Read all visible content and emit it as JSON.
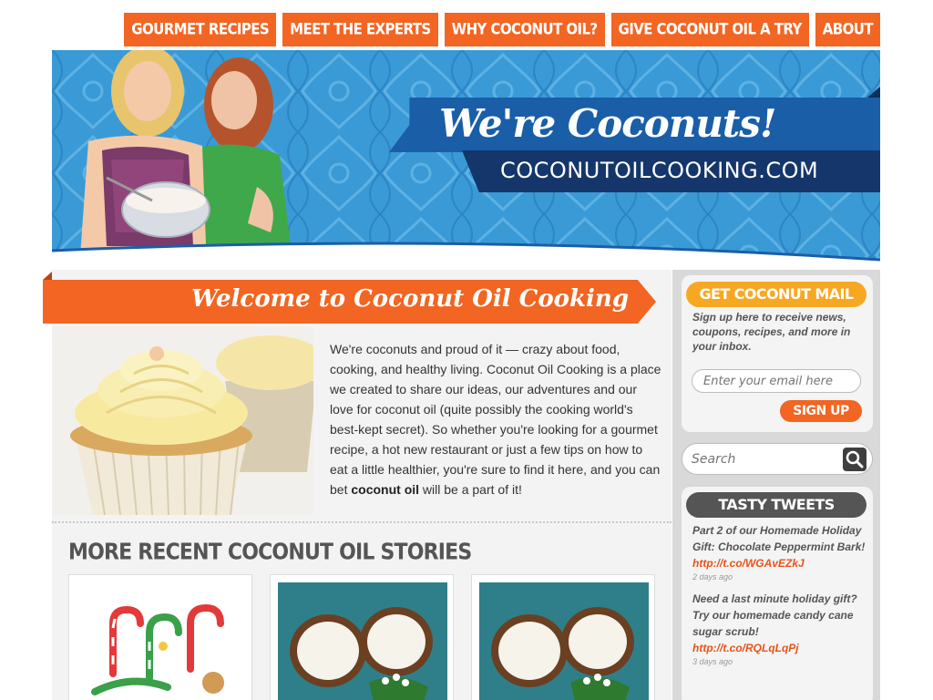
{
  "nav": {
    "items": [
      "GOURMET RECIPES",
      "MEET THE EXPERTS",
      "WHY COCONUT OIL?",
      "GIVE COCONUT OIL A TRY",
      "ABOUT"
    ]
  },
  "hero": {
    "headline": "We're Coconuts!",
    "site_name": "COCONUTOILCOOKING.COM"
  },
  "welcome": {
    "title": "Welcome to Coconut Oil Cooking",
    "body_before_bold": "We're coconuts and proud of it — crazy about food, cooking, and healthy living. Coconut Oil Cooking is a place we created to share our ideas, our adventures and our love for coconut oil (quite possibly the cooking world's best-kept secret). So whether you're looking for a gourmet recipe, a hot new restaurant or just a few tips on how to eat a little healthier, you're sure to find it here, and you can bet ",
    "body_bold": "coconut oil",
    "body_after_bold": " will be a part of it!"
  },
  "stories": {
    "title": "MORE RECENT COCONUT OIL STORIES"
  },
  "newsletter": {
    "title": "GET COCONUT MAIL",
    "description": "Sign up here to receive news, coupons, recipes, and more in your inbox.",
    "email_placeholder": "Enter your email here",
    "signup_label": "SIGN UP"
  },
  "search": {
    "placeholder": "Search"
  },
  "tweets": {
    "title": "TASTY TWEETS",
    "items": [
      {
        "text": "Part 2 of our Homemade Holiday Gift: Chocolate Peppermint Bark! ",
        "link": "http://t.co/WGAvEZkJ",
        "ago": "2 days ago"
      },
      {
        "text": "Need a last minute holiday gift? Try our homemade candy cane sugar scrub! ",
        "link": "http://t.co/RQLqLqPj",
        "ago": "3 days ago"
      }
    ]
  },
  "colors": {
    "brand_orange": "#f26522",
    "hero_blue": "#3a9ad6",
    "ribbon_blue": "#1a5ea8",
    "ribbon_navy": "#14366a",
    "tweet_link": "#e8531a",
    "newsletter_pill": "#f7a823",
    "tweets_pill": "#555555"
  }
}
